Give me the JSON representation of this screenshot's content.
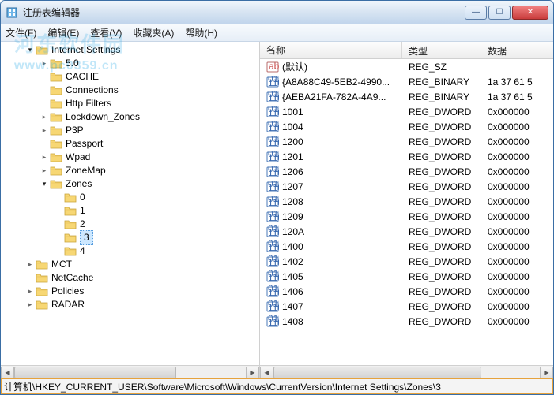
{
  "window": {
    "title": "注册表编辑器"
  },
  "winbuttons": {
    "min": "—",
    "max": "☐",
    "close": "✕"
  },
  "menu": {
    "file": "文件(F)",
    "edit": "编辑(E)",
    "view": "查看(V)",
    "fav": "收藏夹(A)",
    "help": "帮助(H)"
  },
  "watermark": {
    "cn": "河东软件园",
    "url": "www.pc0359.cn"
  },
  "tree": {
    "root": "Internet Settings",
    "children": [
      {
        "label": "5.0",
        "expandable": true,
        "expanded": false
      },
      {
        "label": "CACHE"
      },
      {
        "label": "Connections"
      },
      {
        "label": "Http Filters"
      },
      {
        "label": "Lockdown_Zones",
        "expandable": true,
        "expanded": false
      },
      {
        "label": "P3P",
        "expandable": true,
        "expanded": false
      },
      {
        "label": "Passport"
      },
      {
        "label": "Wpad",
        "expandable": true,
        "expanded": false
      },
      {
        "label": "ZoneMap",
        "expandable": true,
        "expanded": false
      },
      {
        "label": "Zones",
        "expandable": true,
        "expanded": true,
        "children": [
          {
            "label": "0"
          },
          {
            "label": "1"
          },
          {
            "label": "2"
          },
          {
            "label": "3",
            "selected": true
          },
          {
            "label": "4"
          }
        ]
      }
    ],
    "siblings": [
      {
        "label": "MCT",
        "expandable": true,
        "expanded": false
      },
      {
        "label": "NetCache"
      },
      {
        "label": "Policies",
        "expandable": true,
        "expanded": false
      },
      {
        "label": "RADAR",
        "expandable": true,
        "expanded": false
      }
    ]
  },
  "list": {
    "headers": {
      "name": "名称",
      "type": "类型",
      "data": "数据"
    },
    "rows": [
      {
        "name": "(默认)",
        "type": "REG_SZ",
        "data": "",
        "kind": "sz"
      },
      {
        "name": "{A8A88C49-5EB2-4990...",
        "type": "REG_BINARY",
        "data": "1a 37 61 5",
        "kind": "bin"
      },
      {
        "name": "{AEBA21FA-782A-4A9...",
        "type": "REG_BINARY",
        "data": "1a 37 61 5",
        "kind": "bin"
      },
      {
        "name": "1001",
        "type": "REG_DWORD",
        "data": "0x000000",
        "kind": "bin"
      },
      {
        "name": "1004",
        "type": "REG_DWORD",
        "data": "0x000000",
        "kind": "bin"
      },
      {
        "name": "1200",
        "type": "REG_DWORD",
        "data": "0x000000",
        "kind": "bin"
      },
      {
        "name": "1201",
        "type": "REG_DWORD",
        "data": "0x000000",
        "kind": "bin"
      },
      {
        "name": "1206",
        "type": "REG_DWORD",
        "data": "0x000000",
        "kind": "bin"
      },
      {
        "name": "1207",
        "type": "REG_DWORD",
        "data": "0x000000",
        "kind": "bin"
      },
      {
        "name": "1208",
        "type": "REG_DWORD",
        "data": "0x000000",
        "kind": "bin"
      },
      {
        "name": "1209",
        "type": "REG_DWORD",
        "data": "0x000000",
        "kind": "bin"
      },
      {
        "name": "120A",
        "type": "REG_DWORD",
        "data": "0x000000",
        "kind": "bin"
      },
      {
        "name": "1400",
        "type": "REG_DWORD",
        "data": "0x000000",
        "kind": "bin"
      },
      {
        "name": "1402",
        "type": "REG_DWORD",
        "data": "0x000000",
        "kind": "bin"
      },
      {
        "name": "1405",
        "type": "REG_DWORD",
        "data": "0x000000",
        "kind": "bin"
      },
      {
        "name": "1406",
        "type": "REG_DWORD",
        "data": "0x000000",
        "kind": "bin"
      },
      {
        "name": "1407",
        "type": "REG_DWORD",
        "data": "0x000000",
        "kind": "bin"
      },
      {
        "name": "1408",
        "type": "REG_DWORD",
        "data": "0x000000",
        "kind": "bin"
      }
    ]
  },
  "statusbar": {
    "path": "计算机\\HKEY_CURRENT_USER\\Software\\Microsoft\\Windows\\CurrentVersion\\Internet Settings\\Zones\\3"
  },
  "scroll": {
    "left": "◀",
    "right": "▶"
  }
}
